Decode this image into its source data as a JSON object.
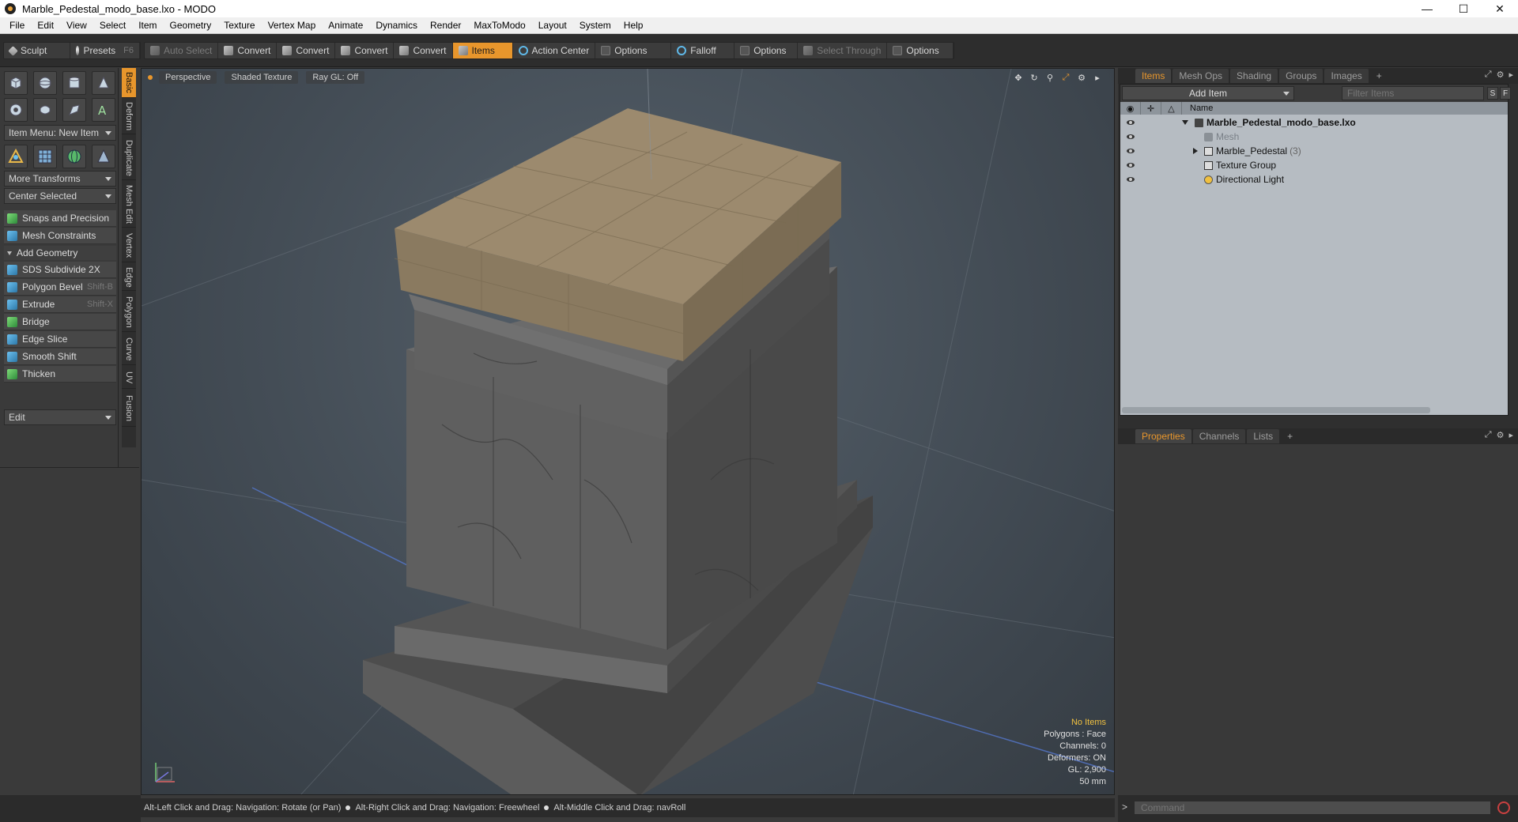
{
  "window": {
    "title": "Marble_Pedestal_modo_base.lxo - MODO",
    "minimize": "—",
    "maximize": "☐",
    "close": "✕"
  },
  "menu": [
    "File",
    "Edit",
    "View",
    "Select",
    "Item",
    "Geometry",
    "Texture",
    "Vertex Map",
    "Animate",
    "Dynamics",
    "Render",
    "MaxToModo",
    "Layout",
    "System",
    "Help"
  ],
  "toolbar": {
    "sculpt": "Sculpt",
    "presets": "Presets",
    "presets_shortcut": "F6",
    "auto_select": "Auto Select",
    "convert1": "Convert",
    "convert2": "Convert",
    "convert3": "Convert",
    "convert4": "Convert",
    "items": "Items",
    "action_center": "Action Center",
    "options1": "Options",
    "falloff": "Falloff",
    "options2": "Options",
    "select_through": "Select Through",
    "options3": "Options"
  },
  "left_panel": {
    "item_menu": "Item Menu: New Item",
    "more_transforms": "More Transforms",
    "center_selected": "Center Selected",
    "snaps": "Snaps and Precision",
    "mesh_constraints": "Mesh Constraints",
    "add_geometry": "Add Geometry",
    "tools": [
      {
        "label": "SDS Subdivide 2X",
        "shortcut": ""
      },
      {
        "label": "Polygon Bevel",
        "shortcut": "Shift-B"
      },
      {
        "label": "Extrude",
        "shortcut": "Shift-X"
      },
      {
        "label": "Bridge",
        "shortcut": ""
      },
      {
        "label": "Edge Slice",
        "shortcut": ""
      },
      {
        "label": "Smooth Shift",
        "shortcut": ""
      },
      {
        "label": "Thicken",
        "shortcut": ""
      }
    ],
    "edit_dropdown": "Edit"
  },
  "vertical_tabs": [
    "Basic",
    "Deform",
    "Duplicate",
    "Mesh Edit",
    "Vertex",
    "Edge",
    "Polygon",
    "Curve",
    "UV",
    "Fusion"
  ],
  "viewport": {
    "perspective": "Perspective",
    "shaded_texture": "Shaded Texture",
    "ray_gl": "Ray GL: Off",
    "stats": {
      "no_items": "No Items",
      "polygons": "Polygons : Face",
      "channels": "Channels: 0",
      "deformers": "Deformers: ON",
      "gl": "GL: 2,900",
      "focal": "50 mm"
    }
  },
  "statusbar": {
    "hint1": "Alt-Left Click and Drag: Navigation: Rotate (or Pan)",
    "hint2": "Alt-Right Click and Drag: Navigation: Freewheel",
    "hint3": "Alt-Middle Click and Drag: navRoll"
  },
  "items_panel": {
    "tabs": [
      "Items",
      "Mesh Ops",
      "Shading",
      "Groups",
      "Images"
    ],
    "add_item": "Add Item",
    "filter_placeholder": "Filter Items",
    "s_btn": "S",
    "f_btn": "F",
    "col_name": "Name",
    "tree": [
      {
        "label": "Marble_Pedestal_modo_base.lxo",
        "count": ""
      },
      {
        "label": "Mesh",
        "count": ""
      },
      {
        "label": "Marble_Pedestal",
        "count": "(3)"
      },
      {
        "label": "Texture Group",
        "count": ""
      },
      {
        "label": "Directional Light",
        "count": ""
      }
    ]
  },
  "properties_panel": {
    "tabs": [
      "Properties",
      "Channels",
      "Lists"
    ]
  },
  "command": {
    "prompt": ">",
    "placeholder": "Command"
  },
  "colors": {
    "accent": "#e8962c",
    "viewport_bg": "#4a535c",
    "marble": "#5e5e5e",
    "top_block": "#9c8a6e"
  }
}
